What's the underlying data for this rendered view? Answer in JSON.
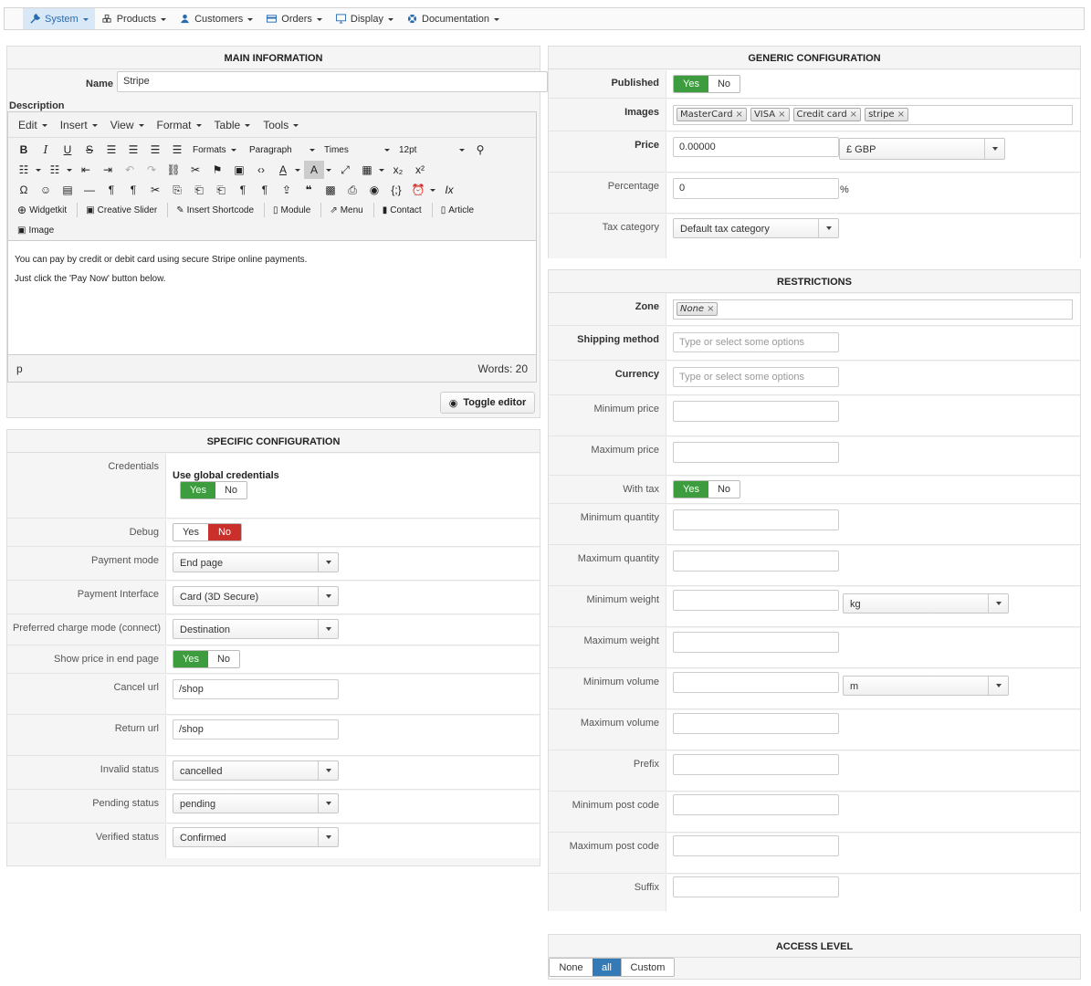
{
  "nav": {
    "items": [
      {
        "label": "System",
        "icon": "wrench-icon",
        "active": true
      },
      {
        "label": "Products",
        "icon": "cubes-icon"
      },
      {
        "label": "Customers",
        "icon": "user-icon"
      },
      {
        "label": "Orders",
        "icon": "credit-card-icon"
      },
      {
        "label": "Display",
        "icon": "monitor-icon"
      },
      {
        "label": "Documentation",
        "icon": "life-ring-icon"
      }
    ]
  },
  "main_info": {
    "title": "MAIN INFORMATION",
    "name_label": "Name",
    "name_value": "Stripe",
    "description_label": "Description",
    "editor": {
      "menus": [
        "Edit",
        "Insert",
        "View",
        "Format",
        "Table",
        "Tools"
      ],
      "formats_label": "Formats",
      "block_label": "Paragraph",
      "font_label": "Times",
      "size_label": "12pt",
      "plugins": [
        "Widgetkit",
        "Creative Slider",
        "Insert Shortcode",
        "Module",
        "Menu",
        "Contact",
        "Article"
      ],
      "image_label": "Image",
      "content_line1": "You can pay by credit or debit card using secure Stripe online payments.",
      "content_line2": "Just click the 'Pay Now' button below.",
      "path": "p",
      "words": "Words: 20"
    },
    "toggle_editor_label": "Toggle editor"
  },
  "specific": {
    "title": "SPECIFIC CONFIGURATION",
    "credentials_label": "Credentials",
    "use_global_label": "Use global credentials",
    "yes": "Yes",
    "no": "No",
    "debug_label": "Debug",
    "payment_mode_label": "Payment mode",
    "payment_mode_value": "End page",
    "payment_interface_label": "Payment Interface",
    "payment_interface_value": "Card (3D Secure)",
    "charge_mode_label": "Preferred charge mode (connect)",
    "charge_mode_value": "Destination",
    "show_price_label": "Show price in end page",
    "cancel_url_label": "Cancel url",
    "cancel_url_value": "/shop",
    "return_url_label": "Return url",
    "return_url_value": "/shop",
    "invalid_status_label": "Invalid status",
    "invalid_status_value": "cancelled",
    "pending_status_label": "Pending status",
    "pending_status_value": "pending",
    "verified_status_label": "Verified status",
    "verified_status_value": "Confirmed"
  },
  "generic": {
    "title": "GENERIC CONFIGURATION",
    "published_label": "Published",
    "yes": "Yes",
    "no": "No",
    "images_label": "Images",
    "images": [
      "MasterCard",
      "VISA",
      "Credit card",
      "stripe"
    ],
    "remove_glyph": "×",
    "price_label": "Price",
    "price_value": "0.00000",
    "currency_value": "£ GBP",
    "percentage_label": "Percentage",
    "percentage_value": "0",
    "percent_sign": "%",
    "tax_category_label": "Tax category",
    "tax_category_value": "Default tax category"
  },
  "restrictions": {
    "title": "RESTRICTIONS",
    "zone_label": "Zone",
    "zone_tag": "None",
    "shipping_method_label": "Shipping method",
    "currency_label": "Currency",
    "select_placeholder": "Type or select some options",
    "min_price_label": "Minimum price",
    "max_price_label": "Maximum price",
    "with_tax_label": "With tax",
    "yes": "Yes",
    "no": "No",
    "min_qty_label": "Minimum quantity",
    "max_qty_label": "Maximum quantity",
    "min_weight_label": "Minimum weight",
    "weight_unit": "kg",
    "max_weight_label": "Maximum weight",
    "min_volume_label": "Minimum volume",
    "volume_unit": "m",
    "max_volume_label": "Maximum volume",
    "prefix_label": "Prefix",
    "min_postcode_label": "Minimum post code",
    "max_postcode_label": "Maximum post code",
    "suffix_label": "Suffix"
  },
  "access": {
    "title": "ACCESS LEVEL",
    "none": "None",
    "all": "all",
    "custom": "Custom"
  }
}
